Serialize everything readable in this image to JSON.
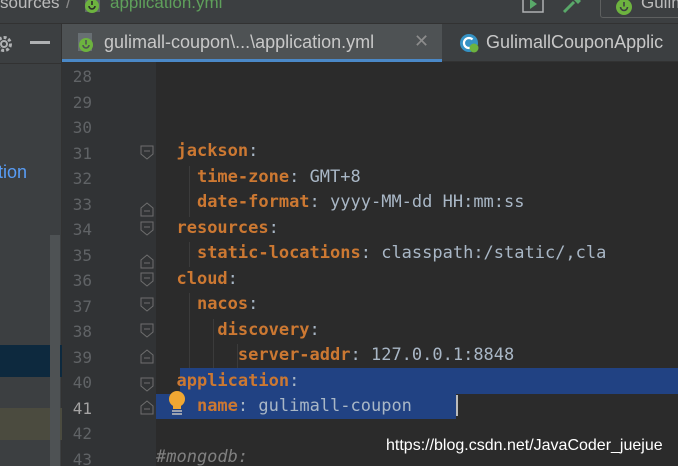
{
  "breadcrumb": {
    "parent": "sources",
    "separator": "/",
    "file": "application.yml"
  },
  "run_config": {
    "label": "Gulim"
  },
  "project_tree": {
    "visible_label": "tion"
  },
  "tabs": [
    {
      "label": "gulimall-coupon\\...\\application.yml",
      "close": "✕",
      "active": true
    },
    {
      "label": "GulimallCouponApplic",
      "active": false
    }
  ],
  "editor": {
    "line_numbers": [
      "28",
      "29",
      "30",
      "31",
      "32",
      "33",
      "34",
      "35",
      "36",
      "37",
      "38",
      "39",
      "40",
      "41",
      "42",
      "43"
    ],
    "current_line": "41",
    "lines": [
      {
        "n": "28",
        "indent": "",
        "key": "",
        "sep": "",
        "value": ""
      },
      {
        "n": "29",
        "indent": "",
        "key": "",
        "sep": "",
        "value": ""
      },
      {
        "n": "30",
        "indent": "",
        "key": "",
        "sep": "",
        "value": ""
      },
      {
        "n": "31",
        "indent": "  ",
        "key": "jackson",
        "sep": ":",
        "value": ""
      },
      {
        "n": "32",
        "indent": "    ",
        "key": "time-zone",
        "sep": ": ",
        "value": "GMT+8"
      },
      {
        "n": "33",
        "indent": "    ",
        "key": "date-format",
        "sep": ": ",
        "value": "yyyy-MM-dd HH:mm:ss"
      },
      {
        "n": "34",
        "indent": "  ",
        "key": "resources",
        "sep": ":",
        "value": ""
      },
      {
        "n": "35",
        "indent": "    ",
        "key": "static-locations",
        "sep": ": ",
        "value": "classpath:/static/,cla"
      },
      {
        "n": "36",
        "indent": "  ",
        "key": "cloud",
        "sep": ":",
        "value": ""
      },
      {
        "n": "37",
        "indent": "    ",
        "key": "nacos",
        "sep": ":",
        "value": ""
      },
      {
        "n": "38",
        "indent": "      ",
        "key": "discovery",
        "sep": ":",
        "value": ""
      },
      {
        "n": "39",
        "indent": "        ",
        "key": "server-addr",
        "sep": ": ",
        "value": "127.0.0.1:8848"
      },
      {
        "n": "40",
        "indent": "  ",
        "key": "application",
        "sep": ":",
        "value": ""
      },
      {
        "n": "41",
        "indent": "    ",
        "key": "name",
        "sep": ": ",
        "value": "gulimall-coupon"
      },
      {
        "n": "42",
        "indent": "",
        "key": "",
        "sep": "",
        "value": ""
      },
      {
        "n": "43",
        "indent": "",
        "key": "",
        "sep": "",
        "value": "",
        "comment": "#mongodb:"
      }
    ]
  },
  "watermark": "https://blog.csdn.net/JavaCoder_juejue",
  "colors": {
    "editor_bg": "#2b2b2b",
    "gutter_bg": "#313335",
    "yaml_key": "#cc7832",
    "text": "#a9b7c6",
    "selection": "#214283",
    "tab_underline": "#4a88c7",
    "spring_green": "#6db33f"
  },
  "icons": [
    "gear-icon",
    "minimize-icon",
    "spring-yml-file-icon",
    "spring-boot-class-icon",
    "run-icon",
    "build-hammer-icon",
    "close-icon",
    "intention-bulb-icon",
    "fold-marker-icon"
  ]
}
